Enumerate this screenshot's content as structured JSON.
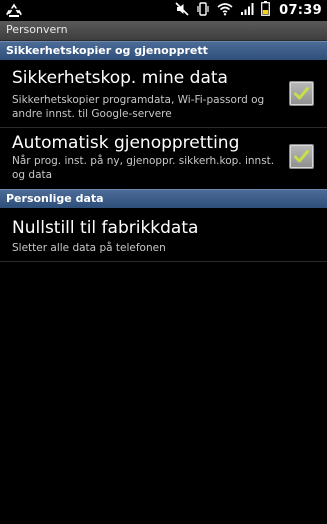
{
  "status_bar": {
    "time": "07:39",
    "icons": [
      "recycle-icon",
      "mute-icon",
      "vibrate-icon",
      "wifi-icon",
      "signal-icon",
      "battery-icon"
    ]
  },
  "title_bar": {
    "title": "Personvern"
  },
  "sections": [
    {
      "header": "Sikkerhetskopier og gjenopprett",
      "items": [
        {
          "title": "Sikkerhetskop. mine data",
          "summary": "Sikkerhetskopier programdata, Wi-Fi-passord og andre innst. til Google-servere",
          "checked": true
        },
        {
          "title": "Automatisk gjenoppretting",
          "summary": "Når prog. inst. på ny, gjenoppr. sikkerh.kop. innst. og data",
          "checked": true
        }
      ]
    },
    {
      "header": "Personlige data",
      "items": [
        {
          "title": "Nullstill til fabrikkdata",
          "summary": "Sletter alle data på telefonen"
        }
      ]
    }
  ],
  "colors": {
    "background": "#000000",
    "section_header": "#3a5a86",
    "checkmark": "#c6e04a",
    "summary_text": "#c8c8c8"
  }
}
